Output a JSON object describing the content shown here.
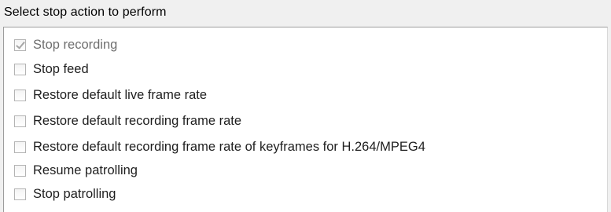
{
  "title": "Select stop action to perform",
  "actions": [
    {
      "label": "Stop recording",
      "checked": true,
      "disabled": true
    },
    {
      "label": "Stop feed",
      "checked": false,
      "disabled": false
    },
    {
      "label": "Restore default live frame rate",
      "checked": false,
      "disabled": false
    },
    {
      "label": "Restore default recording frame rate",
      "checked": false,
      "disabled": false
    },
    {
      "label": "Restore default recording frame rate of keyframes for H.264/MPEG4",
      "checked": false,
      "disabled": false
    },
    {
      "label": "Resume patrolling",
      "checked": false,
      "disabled": false
    },
    {
      "label": "Stop patrolling",
      "checked": false,
      "disabled": false
    }
  ]
}
